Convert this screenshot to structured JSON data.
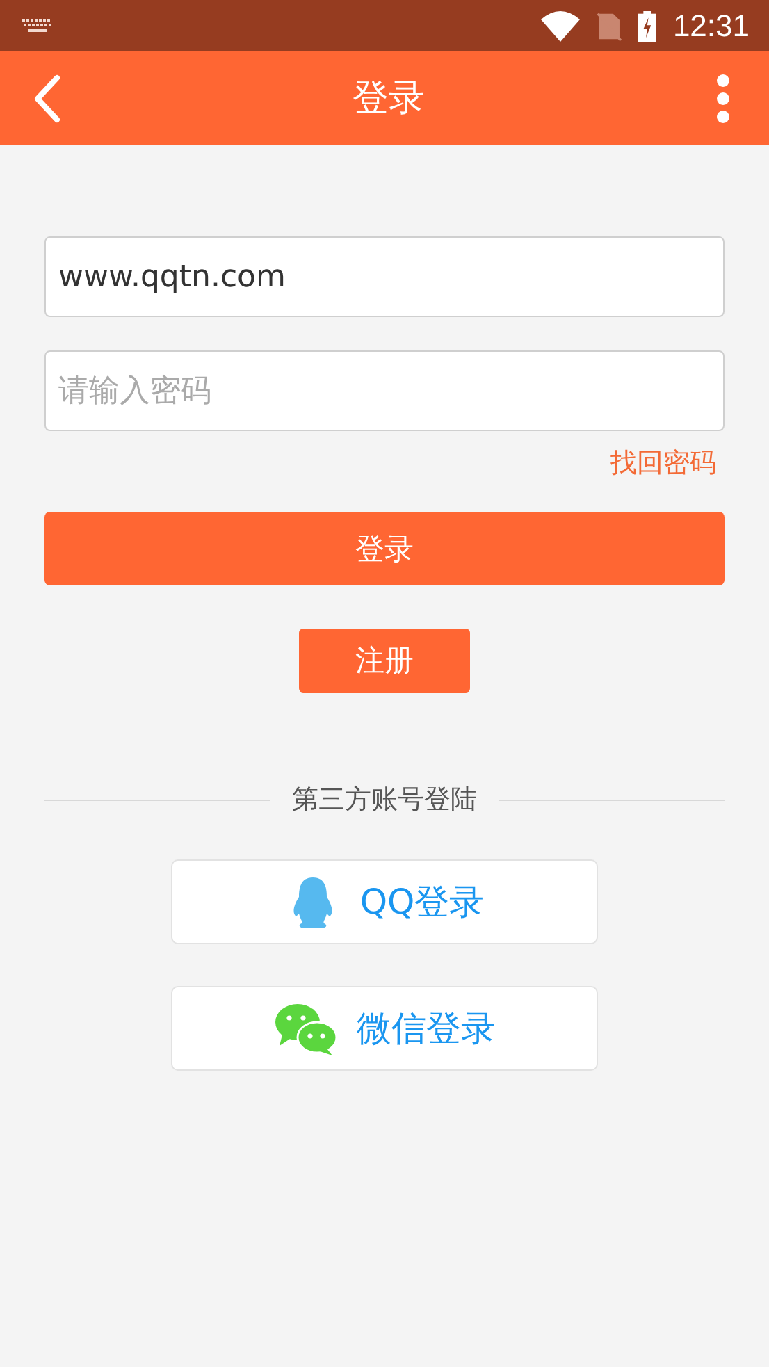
{
  "status_bar": {
    "time": "12:31"
  },
  "app_bar": {
    "title": "登录"
  },
  "form": {
    "username": {
      "value": "www.qqtn.com"
    },
    "password": {
      "placeholder": "请输入密码"
    },
    "forgot_link": "找回密码",
    "login_button": "登录",
    "register_button": "注册"
  },
  "third_party": {
    "heading": "第三方账号登陆",
    "buttons": [
      {
        "kind": "qq",
        "label": "QQ登录"
      },
      {
        "kind": "wechat",
        "label": "微信登录"
      }
    ]
  }
}
